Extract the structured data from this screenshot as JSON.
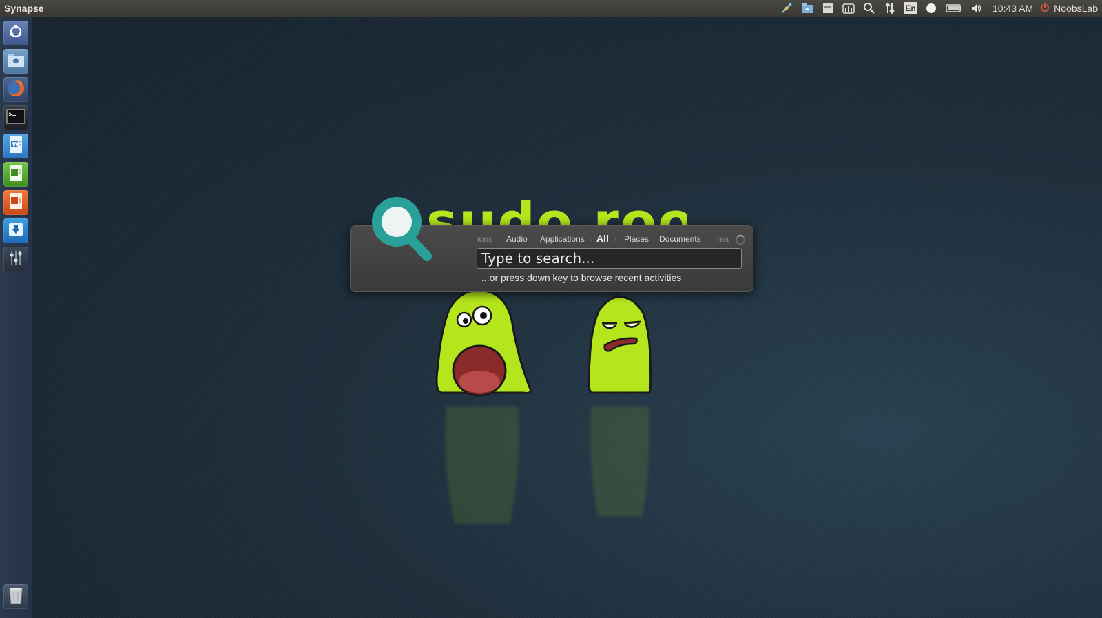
{
  "top_panel": {
    "app_title": "Synapse",
    "keyboard_layout": "En",
    "clock": "10:43 AM",
    "user": "NoobsLab",
    "tray_icons": [
      "synapse-tray-icon",
      "files-tray-icon",
      "clipboard-tray-icon",
      "chart-tray-icon",
      "search-icon",
      "network-icon",
      "keyboard-icon",
      "messaging-icon",
      "battery-icon",
      "volume-icon",
      "power-icon"
    ]
  },
  "launcher": {
    "items": [
      "dash-home",
      "files",
      "firefox",
      "terminal",
      "writer",
      "calc",
      "impress",
      "software-center",
      "system-settings",
      "trash"
    ]
  },
  "synapse": {
    "categories": {
      "prev_faded": "ions",
      "audio": "Audio",
      "applications": "Applications",
      "all": "All",
      "places": "Places",
      "documents": "Documents",
      "next_faded": "Ima"
    },
    "arrow_left": "‹",
    "arrow_right": "›",
    "search_placeholder": "Type to search...",
    "search_value": "",
    "hint": "...or press down key to browse recent activities"
  },
  "wallpaper": {
    "logo_text": "sudo root"
  },
  "colors": {
    "accent": "#2aa198",
    "monster_green": "#b5e61d",
    "mouth": "#7a2a2a",
    "arrow_blue": "#4aa8e0"
  }
}
